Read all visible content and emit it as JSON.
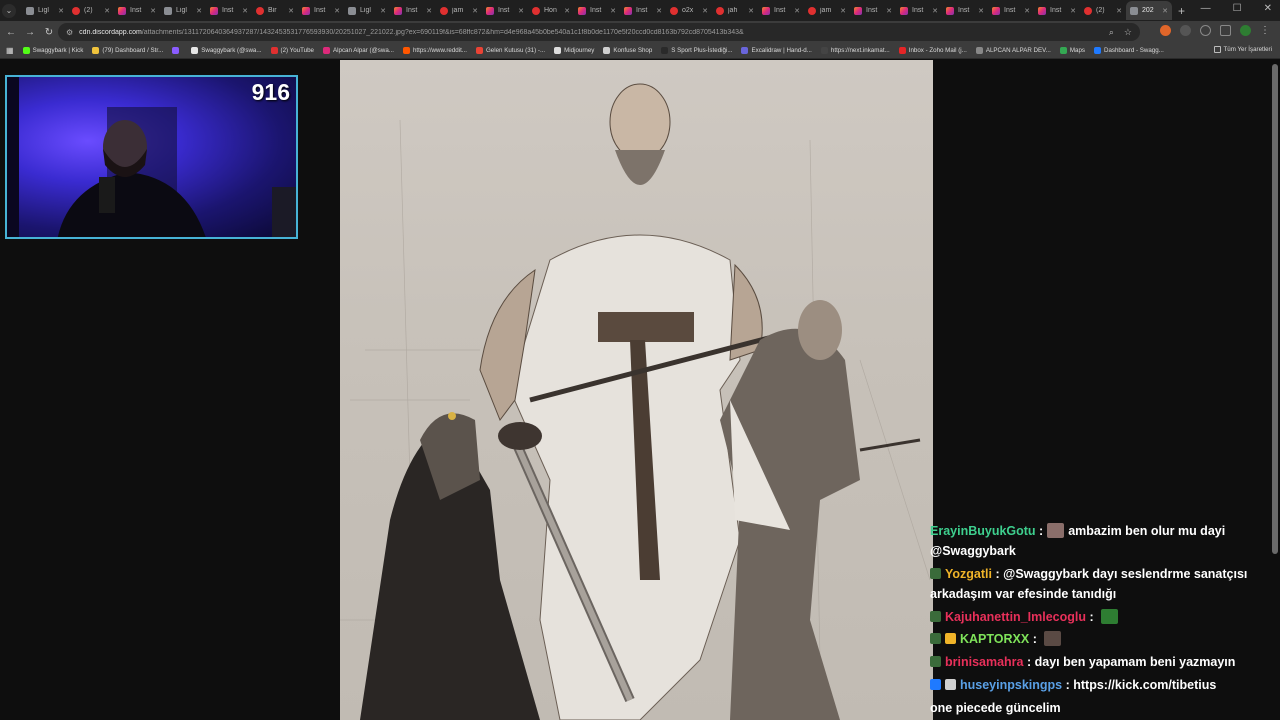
{
  "browser": {
    "tabs": [
      {
        "label": "Ligl",
        "favicon": "lig"
      },
      {
        "label": "(2)",
        "favicon": "yt"
      },
      {
        "label": "Inst",
        "favicon": "ig"
      },
      {
        "label": "Ligl",
        "favicon": "lig"
      },
      {
        "label": "Inst",
        "favicon": "ig"
      },
      {
        "label": "Bir",
        "favicon": "yt"
      },
      {
        "label": "Inst",
        "favicon": "ig"
      },
      {
        "label": "Ligl",
        "favicon": "lig"
      },
      {
        "label": "Inst",
        "favicon": "ig"
      },
      {
        "label": "jam",
        "favicon": "yt"
      },
      {
        "label": "Inst",
        "favicon": "ig"
      },
      {
        "label": "Hon",
        "favicon": "yt"
      },
      {
        "label": "Inst",
        "favicon": "ig"
      },
      {
        "label": "Inst",
        "favicon": "ig"
      },
      {
        "label": "o2x",
        "favicon": "yt"
      },
      {
        "label": "jah",
        "favicon": "yt"
      },
      {
        "label": "Inst",
        "favicon": "ig"
      },
      {
        "label": "jam",
        "favicon": "yt"
      },
      {
        "label": "Inst",
        "favicon": "ig"
      },
      {
        "label": "Inst",
        "favicon": "ig"
      },
      {
        "label": "Inst",
        "favicon": "ig"
      },
      {
        "label": "Inst",
        "favicon": "ig"
      },
      {
        "label": "Inst",
        "favicon": "ig"
      },
      {
        "label": "(2)",
        "favicon": "yt"
      },
      {
        "label": "202",
        "favicon": "lig",
        "active": true
      }
    ],
    "url_host": "cdn.discordapp.com",
    "url_path": "/attachments/1311720640364937287/1432453531776593930/20251027_221022.jpg?ex=690119f&is=68ffc872&hm=d4e968a45b0be540a1c1f8b0de1170e5f20ccd0cd8163b792cd8705413b343&",
    "bookmarks": [
      {
        "label": "Swaggybark | Kick",
        "color": "#53fc18"
      },
      {
        "label": "(79) Dashboard / Str...",
        "color": "#f0c33c"
      },
      {
        "label": "",
        "color": "#8a5cff"
      },
      {
        "label": "Swaggybark (@swa...",
        "color": "#e6e6e6"
      },
      {
        "label": "(2) YouTube",
        "color": "#e03030"
      },
      {
        "label": "Alpcan Alpar (@swa...",
        "color": "#dd2a7b"
      },
      {
        "label": "https://www.reddit...",
        "color": "#ff5700"
      },
      {
        "label": "Gelen Kutusu (31) -...",
        "color": "#ea4335"
      },
      {
        "label": "Midjourney",
        "color": "#dddddd"
      },
      {
        "label": "Konfuse Shop",
        "color": "#cfcfcf"
      },
      {
        "label": "S Sport Plus-İstediği...",
        "color": "#2a2a2a"
      },
      {
        "label": "Excalidraw | Hand-d...",
        "color": "#6965db"
      },
      {
        "label": "https://next.inkamat...",
        "color": "#444"
      },
      {
        "label": "Inbox - Zoho Mail (j...",
        "color": "#e42527"
      },
      {
        "label": "ALPCAN ALPAR DEV...",
        "color": "#888"
      },
      {
        "label": "Maps",
        "color": "#34a853"
      },
      {
        "label": "Dashboard - Swagg...",
        "color": "#1f7aff"
      }
    ],
    "all_bookmarks_label": "Tüm Yer İşaretleri"
  },
  "webcam": {
    "counter": "916"
  },
  "chat": {
    "messages": [
      {
        "user": "ErayinBuyukGotu",
        "user_color": "#3ecf8e",
        "sep": " :",
        "pre_emote": true,
        "text": "ambazim ben olur mu dayi"
      },
      {
        "user": "",
        "text": "@Swaggybark",
        "continuation": true
      },
      {
        "user": "Yozgatli",
        "user_color": "#f0b429",
        "sep": " :",
        "text": "@Swaggybark dayı seslendrme sanatçısı",
        "badge": "#3a6b3a"
      },
      {
        "user": "",
        "text": "arkadaşım var efesinde tanıdığı",
        "continuation": true
      },
      {
        "user": "Kajuhanettin_Imlecoglu",
        "user_color": "#e8305a",
        "sep": " :",
        "text": "",
        "badge": "#3a6b3a",
        "post_emote": "#2e7d32"
      },
      {
        "user": "KAPTORXX",
        "user_color": "#7fe35a",
        "sep": " :",
        "text": "",
        "badge": "#3a6b3a",
        "badge2": "#f0b429",
        "post_emote": "#5a4a44"
      },
      {
        "user": "brinisamahra",
        "user_color": "#e8305a",
        "sep": " :",
        "text": "dayı ben yapamam beni yazmayın",
        "badge": "#3a6b3a"
      },
      {
        "user": "huseyinpskingps",
        "user_color": "#5aa0e6",
        "sep": " :",
        "text": "https://kick.com/tibetius",
        "badge": "#1f7aff",
        "badge2": "#d0d0d0"
      },
      {
        "user": "",
        "text": "one piecede güncelim",
        "continuation": true
      }
    ]
  }
}
